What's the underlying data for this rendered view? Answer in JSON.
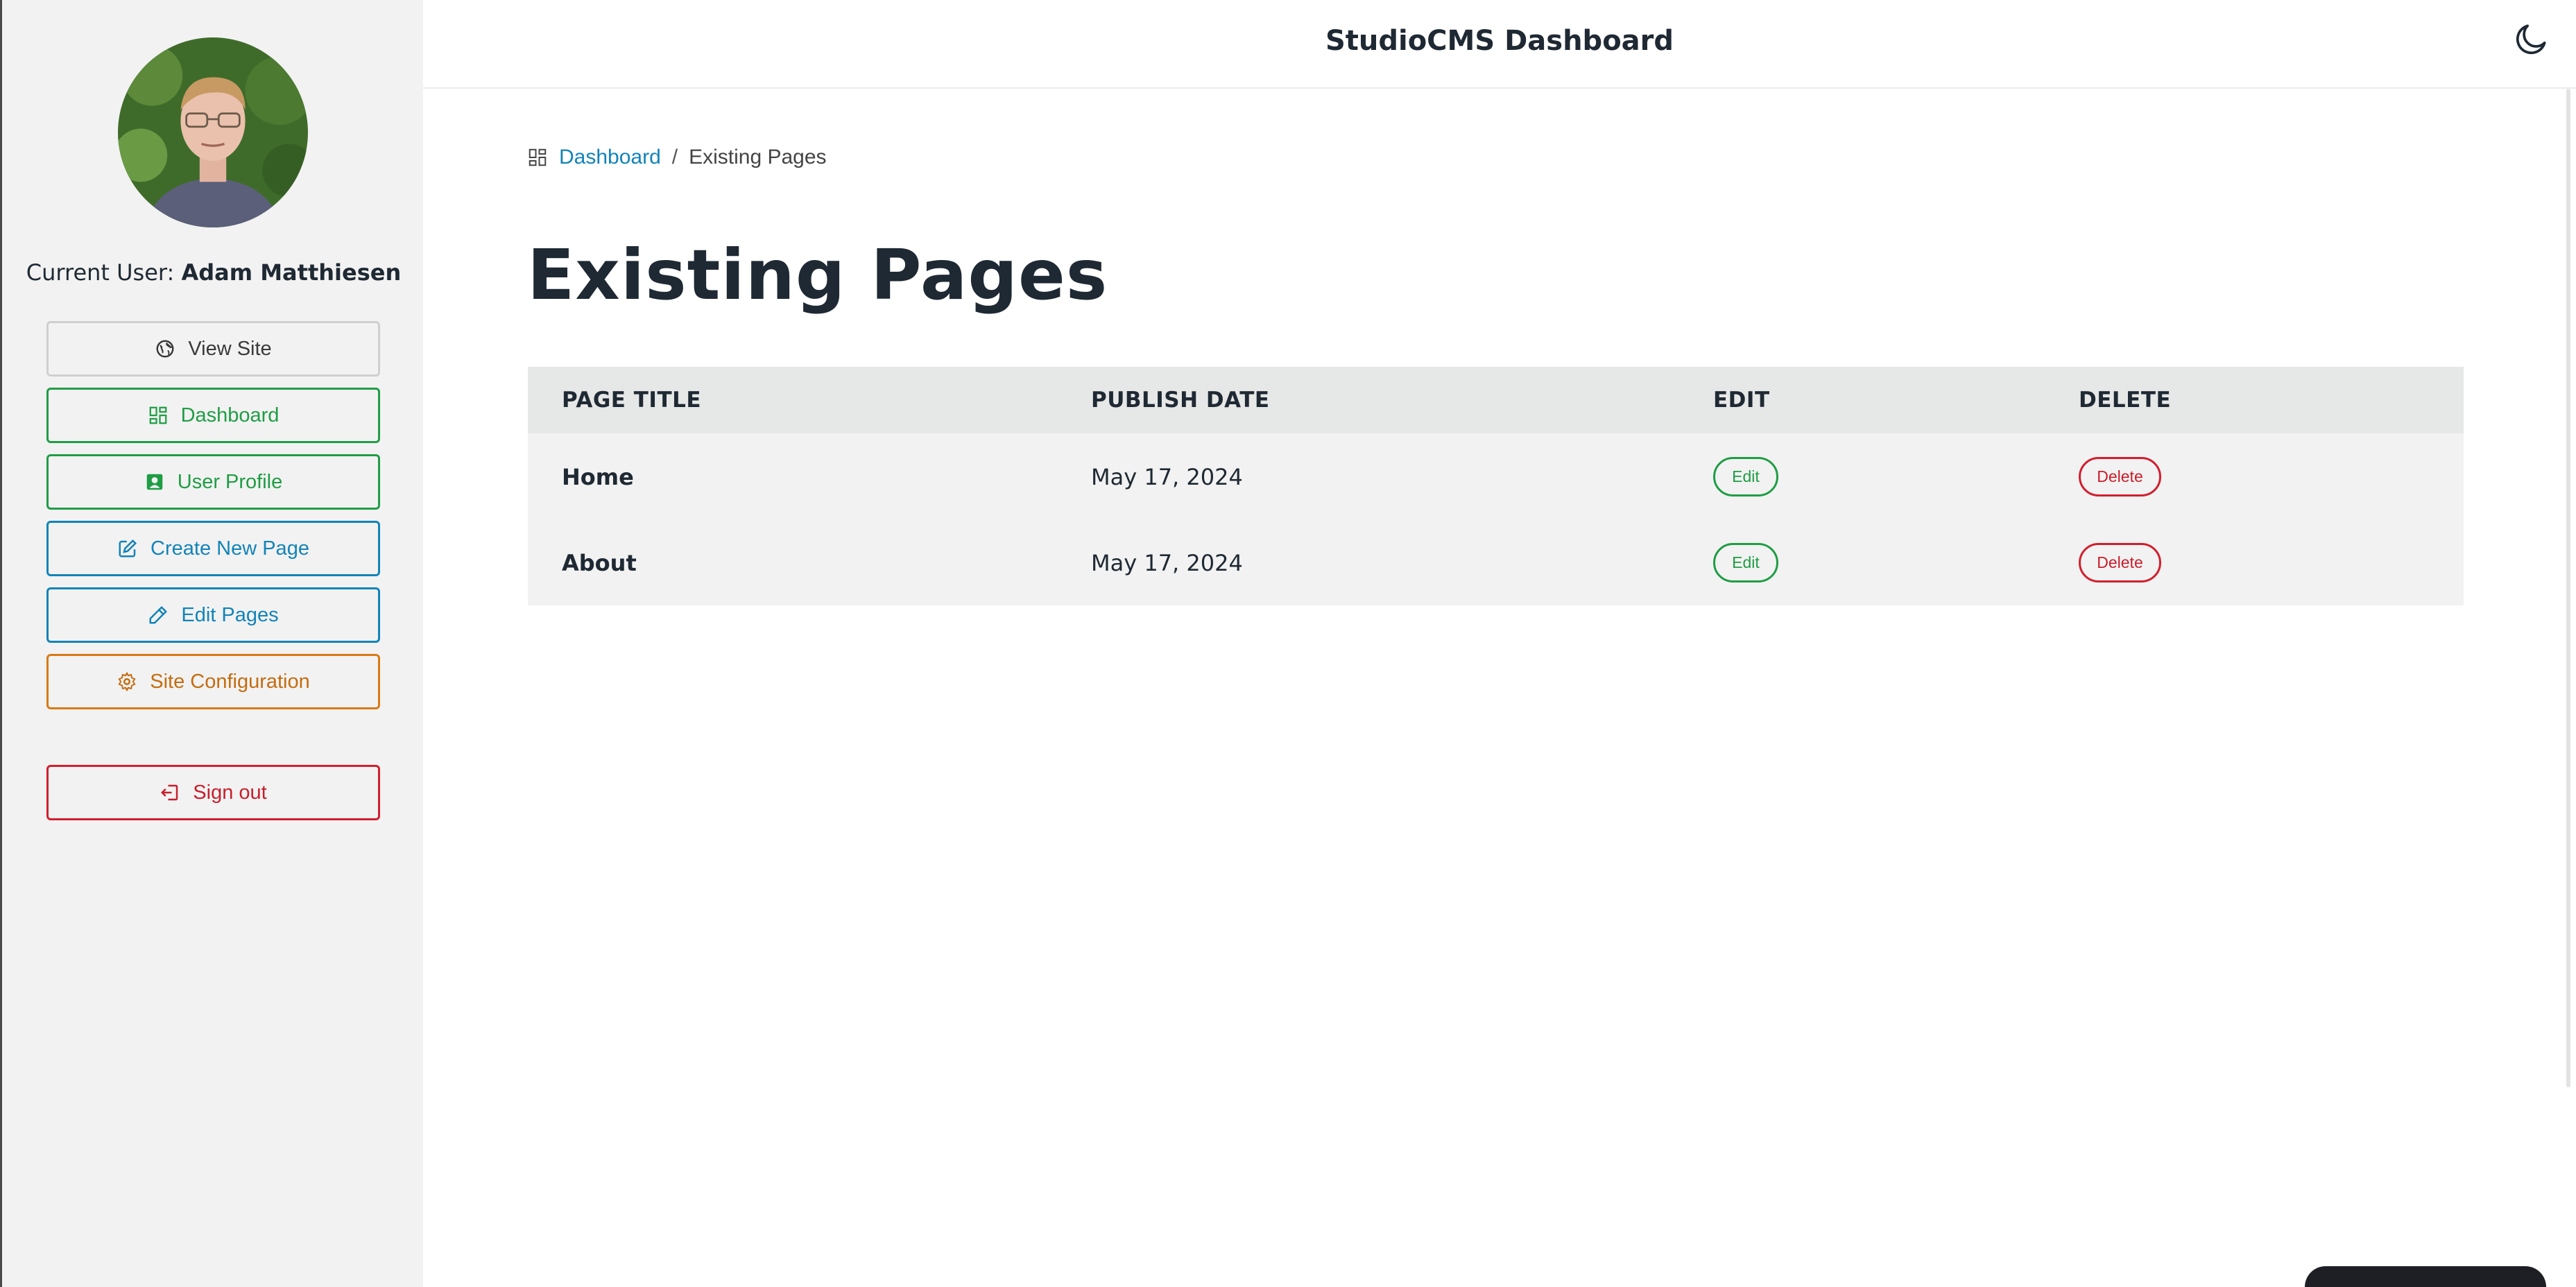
{
  "sidebar": {
    "current_user_label": "Current User:",
    "current_user_name": "Adam Matthiesen",
    "buttons": [
      {
        "label": "View Site",
        "icon": "globe-icon"
      },
      {
        "label": "Dashboard",
        "icon": "dashboard-grid-icon"
      },
      {
        "label": "User Profile",
        "icon": "user-profile-icon"
      },
      {
        "label": "Create New Page",
        "icon": "edit-square-icon"
      },
      {
        "label": "Edit Pages",
        "icon": "pencil-icon"
      },
      {
        "label": "Site Configuration",
        "icon": "gear-icon"
      },
      {
        "label": "Sign out",
        "icon": "sign-out-icon"
      }
    ]
  },
  "header": {
    "title": "StudioCMS Dashboard",
    "theme_toggle_icon": "moon-icon"
  },
  "breadcrumb": {
    "home": "Dashboard",
    "separator": "/",
    "current": "Existing Pages"
  },
  "main": {
    "title": "Existing Pages",
    "table": {
      "columns": [
        "PAGE TITLE",
        "PUBLISH DATE",
        "EDIT",
        "DELETE"
      ],
      "rows": [
        {
          "title": "Home",
          "date": "May 17, 2024",
          "edit": "Edit",
          "delete": "Delete"
        },
        {
          "title": "About",
          "date": "May 17, 2024",
          "edit": "Edit",
          "delete": "Delete"
        }
      ]
    }
  },
  "colors": {
    "green": "#1f9d45",
    "blue": "#1284b8",
    "orange": "#d97a16",
    "red": "#d11f2e",
    "sidebar_bg": "#f2f2f2"
  }
}
